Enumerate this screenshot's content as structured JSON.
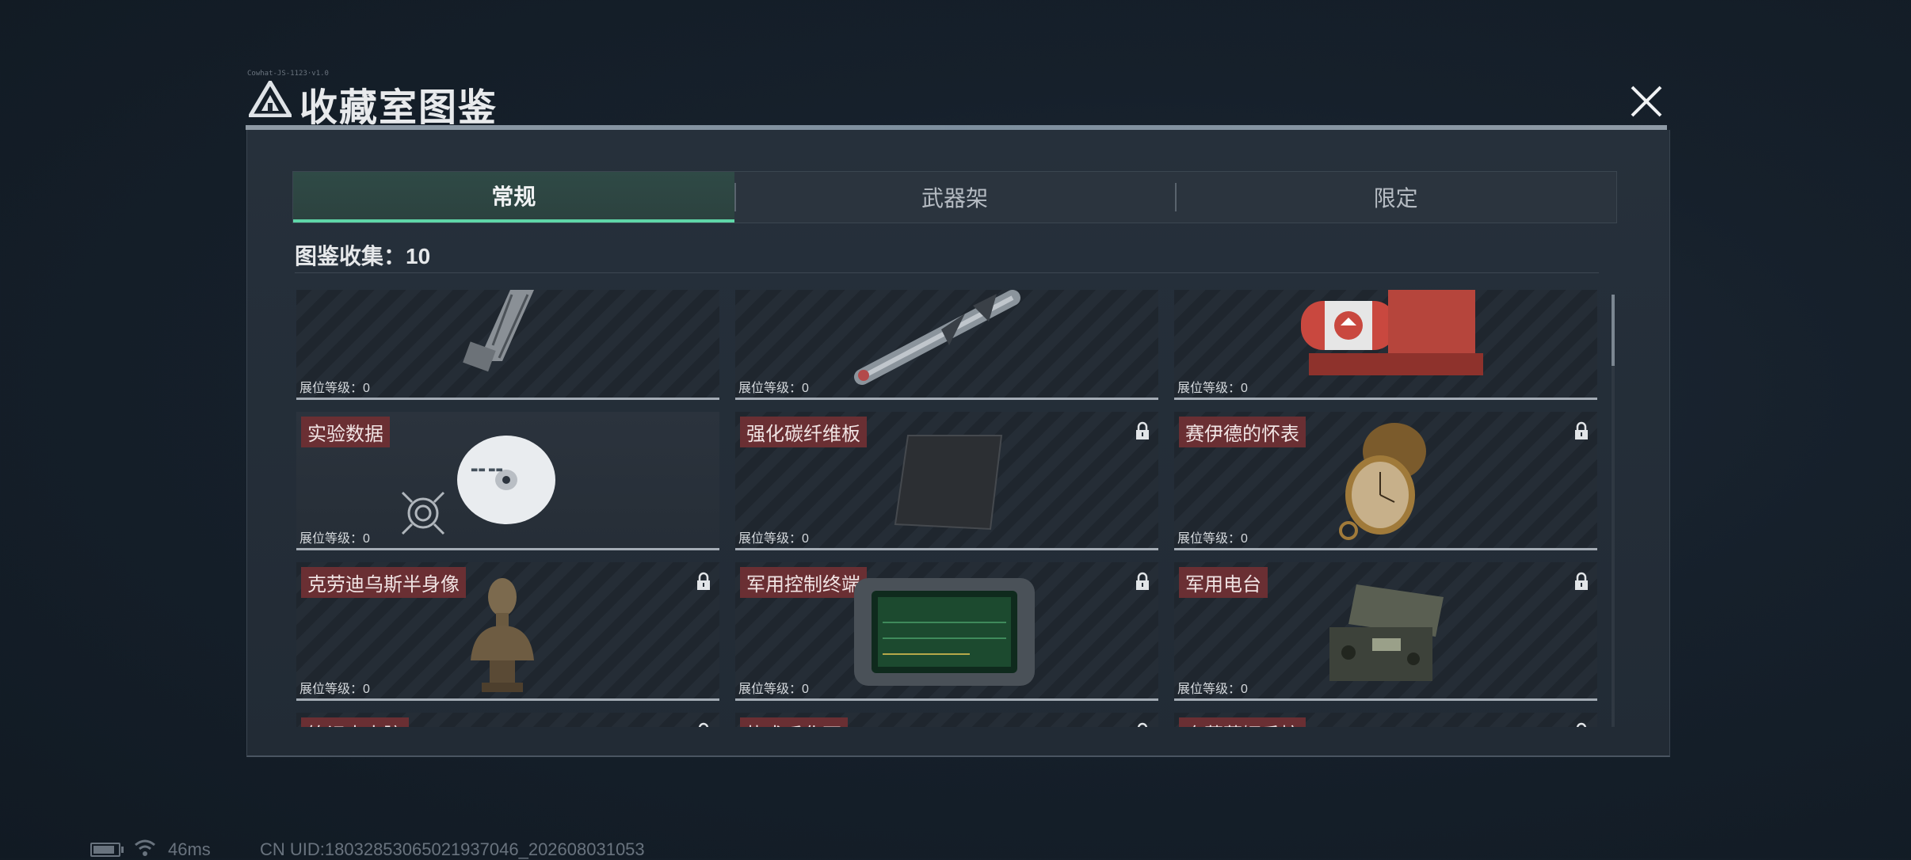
{
  "header": {
    "title": "收藏室图鉴",
    "small_version_text": "Cowhat-JS-1123·v1.0"
  },
  "tabs": [
    {
      "label": "常规",
      "active": true
    },
    {
      "label": "武器架",
      "active": false
    },
    {
      "label": "限定",
      "active": false
    }
  ],
  "collection": {
    "label": "图鉴收集：10"
  },
  "cards": [
    {
      "name": "",
      "level": "展位等级：0",
      "locked": false,
      "icon": "rifle-stock-icon"
    },
    {
      "name": "",
      "level": "展位等级：0",
      "locked": false,
      "icon": "missile-icon"
    },
    {
      "name": "",
      "level": "展位等级：0",
      "locked": false,
      "icon": "fuel-tank-icon"
    },
    {
      "name": "实验数据",
      "level": "展位等级：0",
      "locked": false,
      "icon": "disc-icon"
    },
    {
      "name": "强化碳纤维板",
      "level": "展位等级：0",
      "locked": true,
      "icon": "carbon-plate-icon"
    },
    {
      "name": "赛伊德的怀表",
      "level": "展位等级：0",
      "locked": true,
      "icon": "pocket-watch-icon"
    },
    {
      "name": "克劳迪乌斯半身像",
      "level": "展位等级：0",
      "locked": true,
      "icon": "bust-icon"
    },
    {
      "name": "军用控制终端",
      "level": "展位等级：0",
      "locked": true,
      "icon": "control-terminal-icon"
    },
    {
      "name": "军用电台",
      "level": "展位等级：0",
      "locked": true,
      "icon": "radio-icon"
    },
    {
      "name": "笔记本电脑",
      "level": "",
      "locked": true,
      "icon": "laptop-icon"
    },
    {
      "name": "执术瓜化石",
      "level": "",
      "locked": true,
      "icon": "fossil-icon"
    },
    {
      "name": "奥莉薇娅香槟",
      "level": "",
      "locked": true,
      "icon": "champagne-icon"
    }
  ],
  "status_bar": {
    "ping": "46ms",
    "uid": "CN UID:1803285306502193704​6_202608031053",
    "battery_level": 0.85
  },
  "colors": {
    "accent_green": "#5fd6a8",
    "label_red": "#6a2f33"
  }
}
